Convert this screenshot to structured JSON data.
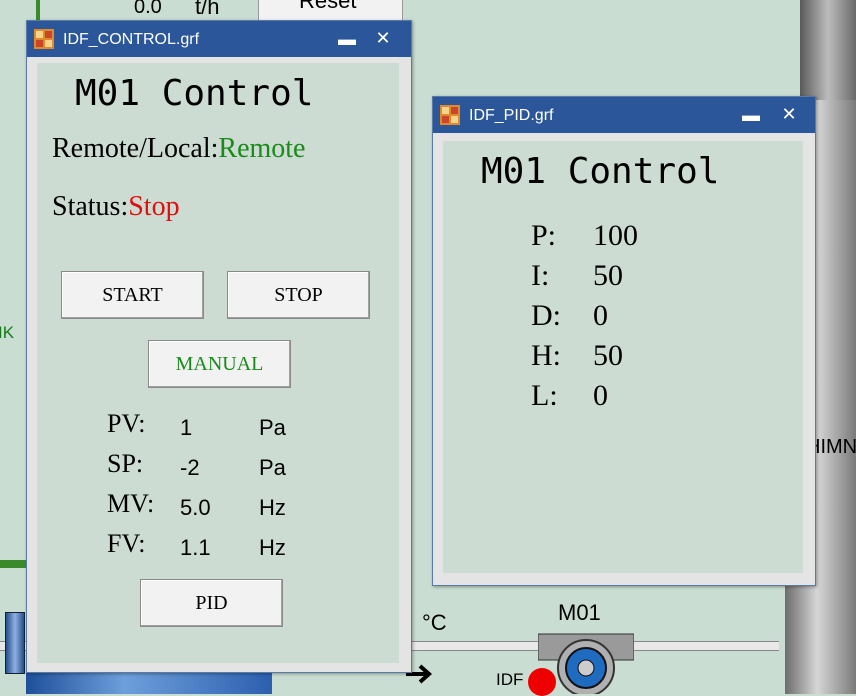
{
  "background": {
    "top_reading_value": "0.0",
    "top_reading_unit": "t/h",
    "top_button_label": "Reset",
    "left_edge_fragment": "IK",
    "right_edge_fragment": "HIMN",
    "temp_unit": "°C",
    "fan_label": "M01",
    "idf_label": "IDF"
  },
  "control_window": {
    "title": "IDF_CONTROL.grf",
    "minimize_glyph": "▬",
    "close_glyph": "✕",
    "heading": "M01 Control",
    "mode_label": "Remote/Local:",
    "mode_value": "Remote",
    "status_label": "Status:",
    "status_value": "Stop",
    "start_label": "START",
    "stop_label": "STOP",
    "manual_label": "MANUAL",
    "pid_label": "PID",
    "rows": [
      {
        "label": "PV:",
        "value": "1",
        "unit": "Pa"
      },
      {
        "label": "SP:",
        "value": "-2",
        "unit": "Pa"
      },
      {
        "label": "MV:",
        "value": "5.0",
        "unit": "Hz"
      },
      {
        "label": "FV:",
        "value": "1.1",
        "unit": "Hz"
      }
    ]
  },
  "pid_window": {
    "title": "IDF_PID.grf",
    "minimize_glyph": "▬",
    "close_glyph": "✕",
    "heading": "M01 Control",
    "params": [
      {
        "label": "P:",
        "value": "100"
      },
      {
        "label": "I:",
        "value": "50"
      },
      {
        "label": "D:",
        "value": "0"
      },
      {
        "label": "H:",
        "value": "50"
      },
      {
        "label": "L:",
        "value": "0"
      }
    ]
  },
  "colors": {
    "title_bar": "#2b579a",
    "panel": "#cddcd3",
    "remote_green": "#1a8a1a",
    "stop_red": "#e01010"
  }
}
